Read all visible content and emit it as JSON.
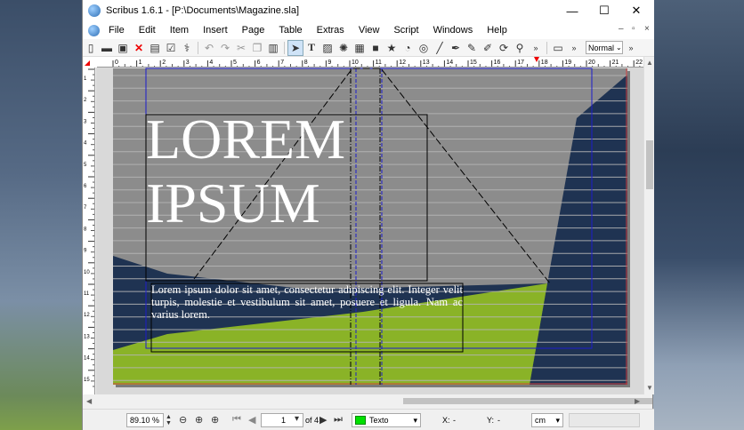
{
  "window": {
    "title": "Scribus 1.6.1 - [P:\\Documents\\Magazine.sla]",
    "controls": [
      "—",
      "☐",
      "✕"
    ]
  },
  "menubar": {
    "items": [
      "File",
      "Edit",
      "Item",
      "Insert",
      "Page",
      "Table",
      "Extras",
      "View",
      "Script",
      "Windows",
      "Help"
    ],
    "mdi_controls": [
      "–",
      "▫",
      "×"
    ]
  },
  "toolbar": {
    "preview_mode": "Normal"
  },
  "ruler": {
    "top_labels": [
      "0",
      "1",
      "2",
      "3",
      "4",
      "5",
      "6",
      "7",
      "8",
      "9",
      "10",
      "11",
      "12",
      "13",
      "14",
      "15",
      "16",
      "17",
      "18",
      "19",
      "20",
      "21",
      "22"
    ],
    "left_labels": [
      "1",
      "2",
      "3",
      "4",
      "5",
      "6",
      "7",
      "8",
      "9",
      "10",
      "11",
      "12",
      "13",
      "14",
      "15"
    ]
  },
  "document": {
    "headline_line1": "LOREM",
    "headline_line2": "IPSUM",
    "body_text": "Lorem ipsum dolor sit amet, consectetur adipiscing elit. Integer velit turpis, molestie et vestibulum sit amet, posuere et ligula. Nam ac varius lorem.",
    "colors": {
      "background_gray": "#8a8a8a",
      "navy": "#1f3352",
      "green": "#8ab327",
      "text_white": "#ffffff"
    }
  },
  "statusbar": {
    "zoom": "89.10 %",
    "page_current": "1",
    "page_total": "of 4",
    "layer": "Texto",
    "x_label": "X:",
    "x_value": "-",
    "y_label": "Y:",
    "y_value": "-",
    "unit": "cm"
  }
}
